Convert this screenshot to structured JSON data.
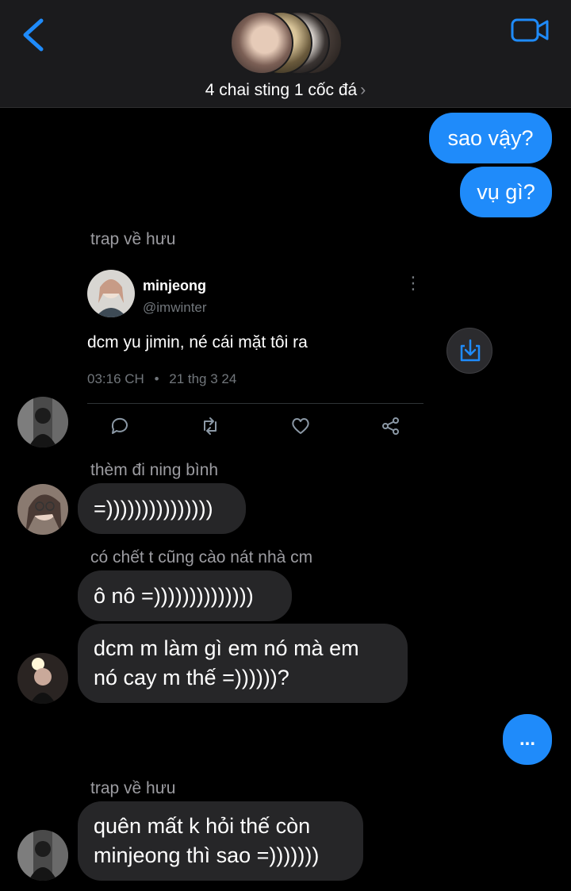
{
  "header": {
    "group_name": "4 chai sting 1 cốc đá",
    "chevron": "›",
    "back_icon": "chevron-left-icon",
    "video_icon": "video-camera-icon",
    "accent": "#1f8bfa"
  },
  "messages": {
    "out1": "sao vậy?",
    "out2": "vụ gì?",
    "sender1": "trap về hưu",
    "sender2": "thèm đi ning bình",
    "in2": "=)))))))))))))))",
    "sender3": "có chết t cũng cào nát nhà cm",
    "in3": "ô nô =))))))))))))))",
    "in4_line1": "dcm m làm gì em nó mà em",
    "in4_line2": "nó cay m thế =))))))?",
    "typing": "...",
    "sender4": "trap về hưu",
    "in5_line1": "quên mất k hỏi thế còn",
    "in5_line2": "minjeong thì sao =)))))))"
  },
  "tweet": {
    "name": "minjeong",
    "handle": "@imwinter",
    "text": "dcm yu jimin, né cái mặt tôi ra",
    "time": "03:16 CH",
    "dot": "•",
    "date": "21 thg 3 24",
    "menu": "⋮"
  }
}
